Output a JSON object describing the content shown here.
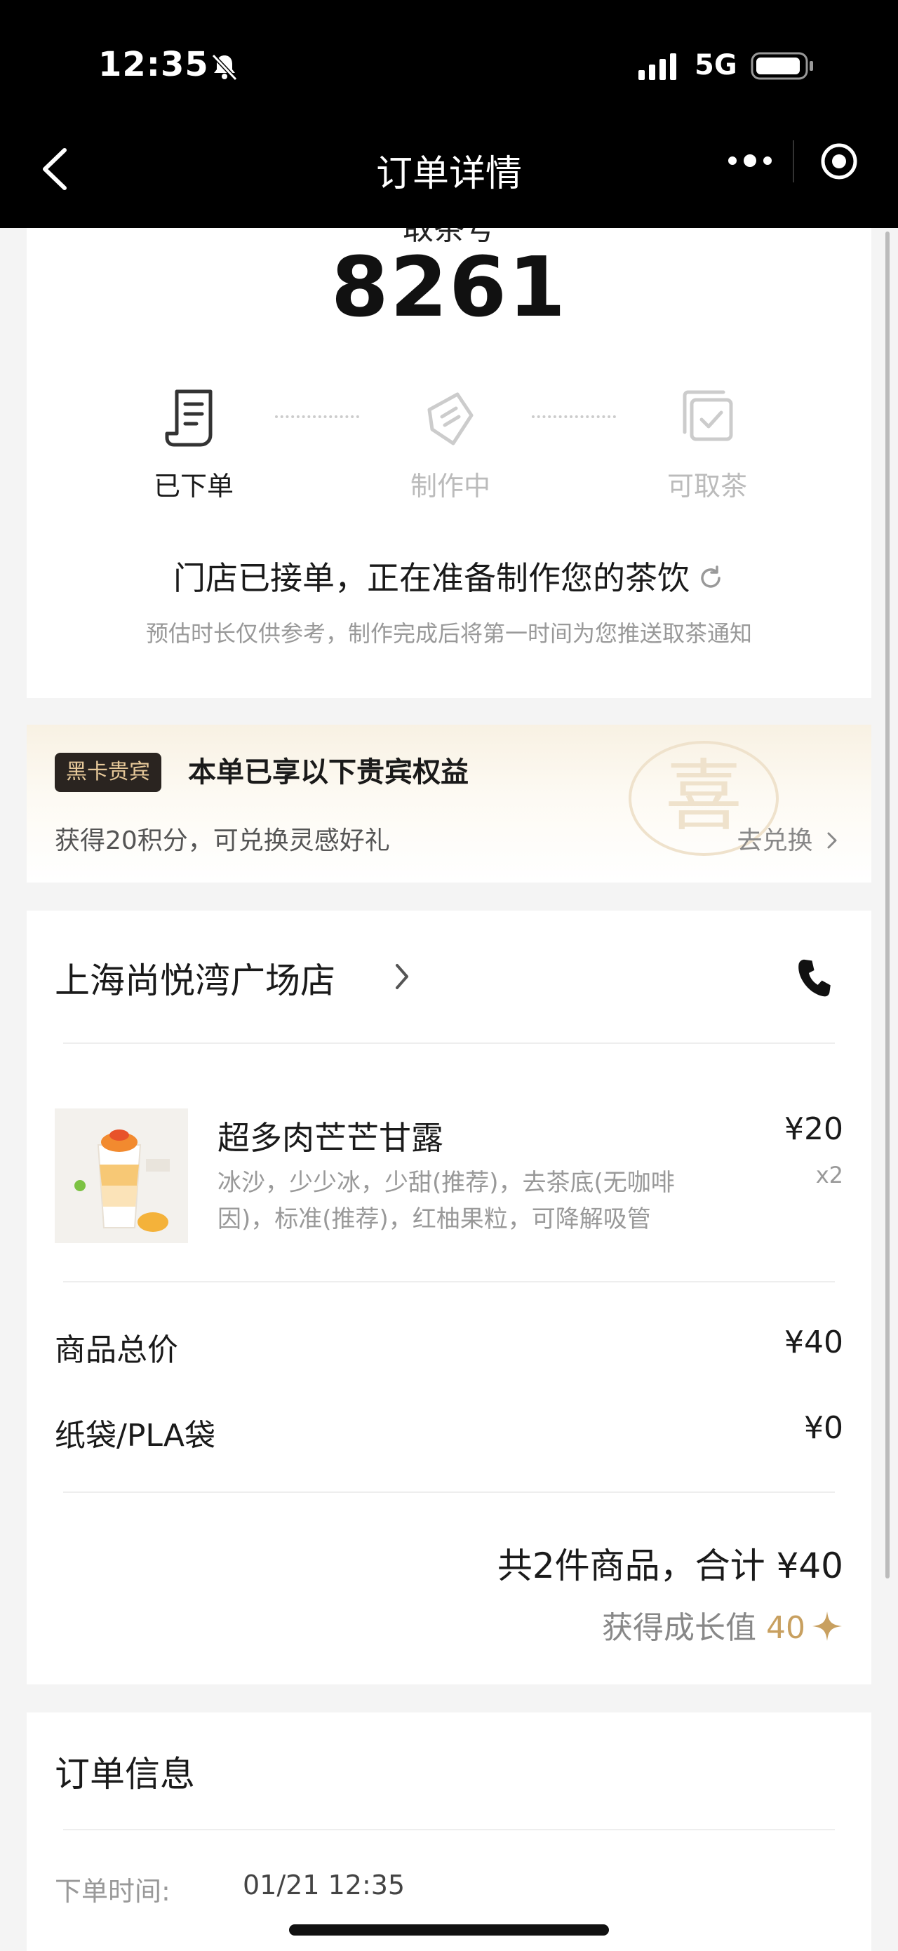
{
  "status_bar": {
    "time": "12:35",
    "network": "5G"
  },
  "header": {
    "title": "订单详情"
  },
  "pickup": {
    "label": "取茶号",
    "number": "8261"
  },
  "steps": [
    {
      "label": "已下单",
      "active": true
    },
    {
      "label": "制作中",
      "active": false
    },
    {
      "label": "可取茶",
      "active": false
    }
  ],
  "status": {
    "message": "门店已接单，正在准备制作您的茶饮",
    "sub": "预估时长仅供参考，制作完成后将第一时间为您推送取茶通知"
  },
  "vip": {
    "badge": "黑卡贵宾",
    "title": "本单已享以下贵宾权益",
    "desc": "获得20积分，可兑换灵感好礼",
    "link": "去兑换",
    "watermark": "喜"
  },
  "store": {
    "name": "上海尚悦湾广场店"
  },
  "product": {
    "name": "超多肉芒芒甘露",
    "options": "冰沙，少少冰，少甜(推荐)，去茶底(无咖啡因)，标准(推荐)，红柚果粒，可降解吸管",
    "price": "¥20",
    "qty": "x2"
  },
  "summary": {
    "subtotal_label": "商品总价",
    "subtotal_value": "¥40",
    "bag_label": "纸袋/PLA袋",
    "bag_value": "¥0",
    "total": "共2件商品，合计 ¥40",
    "growth_label": "获得成长值",
    "growth_value": "40"
  },
  "order_info": {
    "title": "订单信息",
    "time_label": "下单时间:",
    "time_value": "01/21 12:35"
  },
  "colors": {
    "accent_gold": "#c8a060",
    "header_bg": "#000000",
    "vip_badge_bg": "#2a2420"
  }
}
